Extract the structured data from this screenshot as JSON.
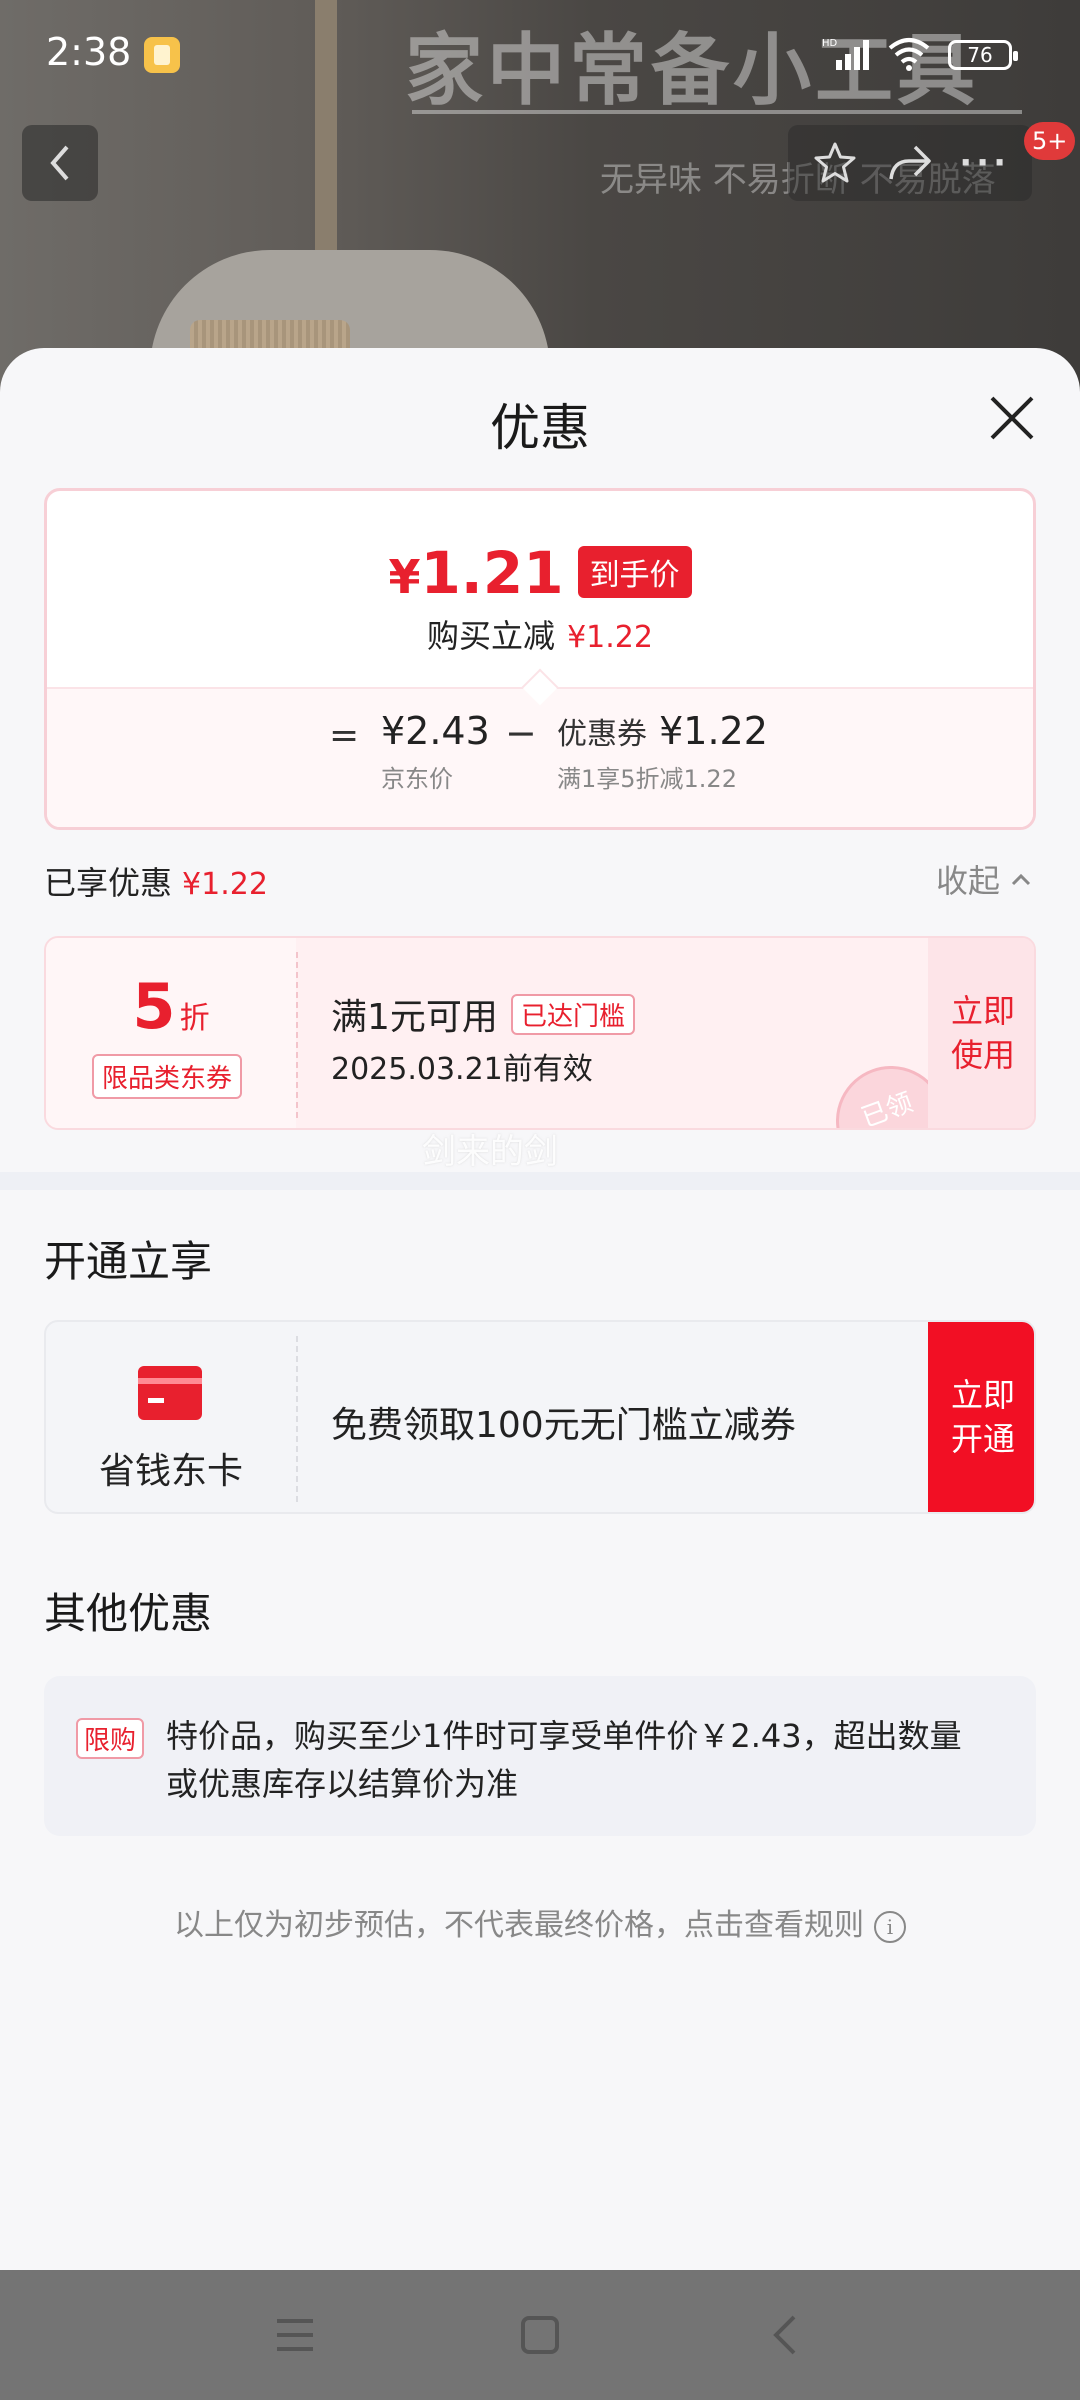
{
  "status_bar": {
    "time": "2:38",
    "battery": "76"
  },
  "background": {
    "headline": "家中常备小工具",
    "tagline": "无异味 不易折断 不易脱落",
    "cart_badge": "5+"
  },
  "sheet": {
    "title": "优惠",
    "final_price": {
      "currency": "¥",
      "amount": "1.21",
      "tag": "到手价",
      "instant_label": "购买立减",
      "instant_amount": "¥1.22"
    },
    "calc": {
      "equals": "=",
      "jd_price": "¥2.43",
      "jd_label": "京东价",
      "minus": "−",
      "coupon_label": "优惠券",
      "coupon_amount": "¥1.22",
      "coupon_desc": "满1享5折减1.22"
    },
    "enjoyed": {
      "label": "已享优惠",
      "amount": "¥1.22",
      "collapse": "收起"
    },
    "coupon": {
      "discount": "5",
      "unit": "折",
      "type": "限品类东券",
      "condition": "满1元可用",
      "reached": "已达门槛",
      "expiry": "2025.03.21前有效",
      "stamp": "已领",
      "button": "立即使用"
    },
    "watermark": "剑来的剑",
    "open_section": {
      "title": "开通立享",
      "card_name": "省钱东卡",
      "desc": "免费领取100元无门槛立减券",
      "button": "立即开通"
    },
    "other_section": {
      "title": "其他优惠",
      "tag": "限购",
      "text": "特价品，购买至少1件时可享受单件价￥2.43，超出数量或优惠库存以结算价为准"
    },
    "disclaimer": "以上仅为初步预估，不代表最终价格，点击查看规则"
  },
  "colors": {
    "accent": "#e8202e",
    "button_red": "#f20f24",
    "sheet_bg": "#f7f7f9"
  }
}
